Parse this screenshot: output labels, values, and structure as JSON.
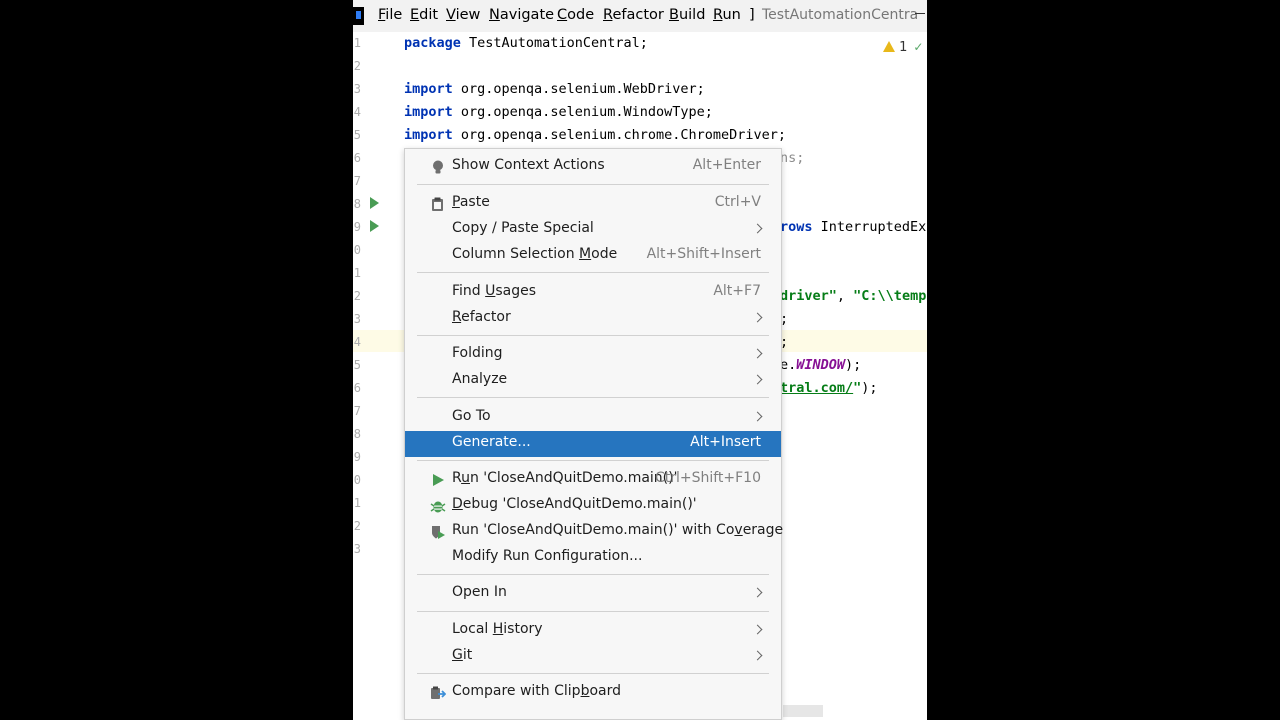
{
  "menubar": {
    "items": [
      {
        "label": "File",
        "mnemonic": "F",
        "rest": "ile"
      },
      {
        "label": "Edit",
        "mnemonic": "E",
        "rest": "dit"
      },
      {
        "label": "View",
        "mnemonic": "V",
        "rest": "iew"
      },
      {
        "label": "Navigate",
        "mnemonic": "N",
        "rest": "avigate"
      },
      {
        "label": "Code",
        "mnemonic": "C",
        "rest": "ode"
      },
      {
        "label": "Refactor",
        "mnemonic": "R",
        "rest": "efactor"
      },
      {
        "label": "Build",
        "mnemonic": "B",
        "rest": "uild"
      },
      {
        "label": "Run",
        "mnemonic": "R",
        "rest": "un"
      },
      {
        "label": "]"
      }
    ],
    "window_title": "TestAutomationCentra"
  },
  "editor": {
    "line_numbers": [
      "1",
      "2",
      "3",
      "4",
      "5",
      "6",
      "7",
      "8",
      "9",
      "0",
      "1",
      "2",
      "3",
      "4",
      "5",
      "6",
      "7",
      "8",
      "9",
      "0",
      "1",
      "2",
      "3"
    ],
    "inspection_count": "1",
    "code": {
      "line1_kw": "package",
      "line1_rest": " TestAutomationCentral;",
      "line3_kw": "import",
      "line3_rest": " org.openqa.selenium.WebDriver;",
      "line4_kw": "import",
      "line4_rest": " org.openqa.selenium.WindowType;",
      "line5_kw": "import",
      "line5_rest": " org.openqa.selenium.chrome.ChromeDriver;",
      "line6_visible": "ns;",
      "line9_kw": "rows",
      "line9_rest": " InterruptedEx",
      "line12_str1": "driver\"",
      "line12_mid": ", ",
      "line12_str2": "\"C:\\\\temp",
      "line13_visible": ";",
      "line14_visible": ";",
      "line15_pre": "e.",
      "line15_field": "WINDOW",
      "line15_post": ");",
      "line16_link": "tral.com/",
      "line16_quote": "\"",
      "line16_post": ");"
    }
  },
  "context_menu": {
    "items": [
      {
        "label": "Show Context Actions",
        "shortcut": "Alt+Enter"
      },
      {
        "pre": "",
        "mn": "P",
        "post": "aste",
        "shortcut": "Ctrl+V"
      },
      {
        "label": "Copy / Paste Special"
      },
      {
        "pre": "Column Selection ",
        "mn": "M",
        "post": "ode",
        "shortcut": "Alt+Shift+Insert"
      },
      {
        "pre": "Find ",
        "mn": "U",
        "post": "sages",
        "shortcut": "Alt+F7"
      },
      {
        "pre": "",
        "mn": "R",
        "post": "efactor"
      },
      {
        "label": "Folding"
      },
      {
        "label": "Analyze"
      },
      {
        "label": "Go To"
      },
      {
        "label": "Generate...",
        "shortcut": "Alt+Insert"
      },
      {
        "pre": "R",
        "mn": "u",
        "post": "n 'CloseAndQuitDemo.main()'",
        "shortcut": "Ctrl+Shift+F10"
      },
      {
        "pre": "",
        "mn": "D",
        "post": "ebug 'CloseAndQuitDemo.main()'"
      },
      {
        "pre": "Run 'CloseAndQuitDemo.main()' with Co",
        "mn": "v",
        "post": "erage"
      },
      {
        "label": "Modify Run Configuration..."
      },
      {
        "label": "Open In"
      },
      {
        "pre": "Local ",
        "mn": "H",
        "post": "istory"
      },
      {
        "pre": "",
        "mn": "G",
        "post": "it"
      },
      {
        "pre": "Compare with Clip",
        "mn": "b",
        "post": "oard"
      }
    ]
  },
  "colors": {
    "highlight": "#2675bf",
    "run_green": "#499c54",
    "keyword": "#0033b3",
    "string": "#067d17"
  }
}
